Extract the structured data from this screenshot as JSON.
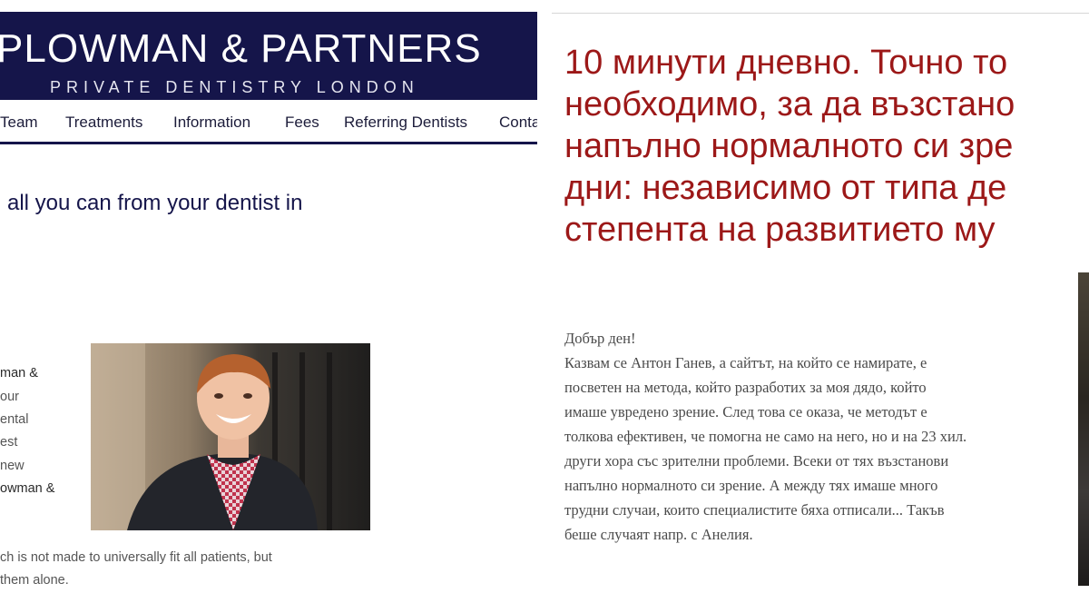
{
  "left_site": {
    "brand": {
      "name": "PLOWMAN & PARTNERS",
      "tagline": "PRIVATE DENTISTRY LONDON"
    },
    "nav": [
      "Team",
      "Treatments",
      "Information",
      "Fees",
      "Referring Dentists",
      "Conta"
    ],
    "intro_heading": "all you can from your dentist in",
    "side_text": [
      "man &",
      "our",
      "ental",
      "est",
      "new",
      "owman &"
    ],
    "portrait_alt": "smiling young man in checked shirt",
    "bottom_text": [
      "ch is not made to universally fit all patients, but",
      "them alone."
    ]
  },
  "right_site": {
    "headline": [
      "10 минути дневно. Точно то",
      "необходимо, за да възстано",
      "напълно нормалното си зре",
      "дни: независимо от типа де",
      "степента на развитието му"
    ],
    "body": [
      "Добър ден!",
      "Казвам се Антон Ганев, а сайтът, на който се намирате, е",
      "посветен на метода, който разработих за моя дядо, който",
      "имаше увредено зрение. След това се оказа, че методът е",
      "толкова ефективен, че помогна не само на него, но и на 23 хил.",
      "други хора със зрителни проблеми. Всеки от тях възстанови",
      "напълно нормалното си зрение. А между тях имаше много",
      "трудни случаи, които специалистите бяха отписали... Такъв",
      "беше случаят напр. с Анелия."
    ]
  },
  "colors": {
    "brand_navy": "#15154a",
    "headline_red": "#9c1818",
    "body_gray": "#4a4a4a"
  }
}
